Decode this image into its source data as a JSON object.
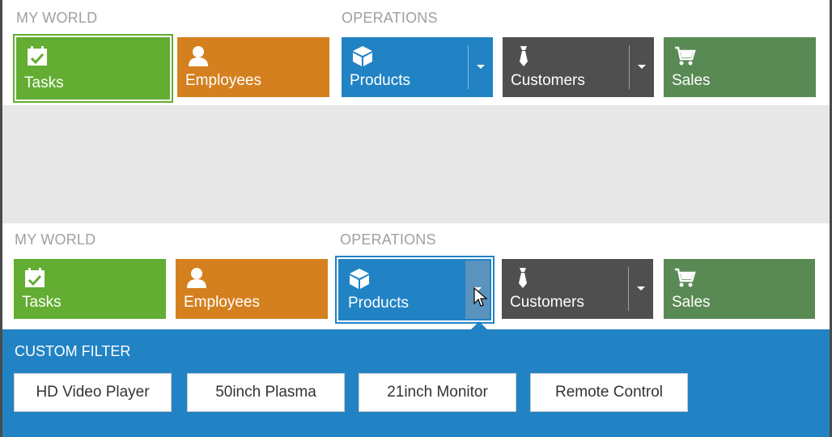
{
  "colors": {
    "tasks": "#62ad32",
    "employees": "#d4801f",
    "products": "#2183c4",
    "customers": "#4f4f4f",
    "sales": "#5a8a54",
    "filter_panel": "#2183c4"
  },
  "top": {
    "my_world_label": "MY WORLD",
    "operations_label": "OPERATIONS",
    "tiles": {
      "tasks": "Tasks",
      "employees": "Employees",
      "products": "Products",
      "customers": "Customers",
      "sales": "Sales"
    }
  },
  "bottom": {
    "my_world_label": "MY WORLD",
    "operations_label": "OPERATIONS",
    "tiles": {
      "tasks": "Tasks",
      "employees": "Employees",
      "products": "Products",
      "customers": "Customers",
      "sales": "Sales"
    }
  },
  "filter": {
    "title": "CUSTOM FILTER",
    "buttons": [
      "HD Video Player",
      "50inch Plasma",
      "21inch Monitor",
      "Remote Control"
    ]
  },
  "icons": {
    "tasks": "calendar-check-icon",
    "employees": "person-icon",
    "products": "cube-icon",
    "customers": "tie-icon",
    "sales": "cart-icon",
    "dropdown": "caret-down-icon"
  }
}
